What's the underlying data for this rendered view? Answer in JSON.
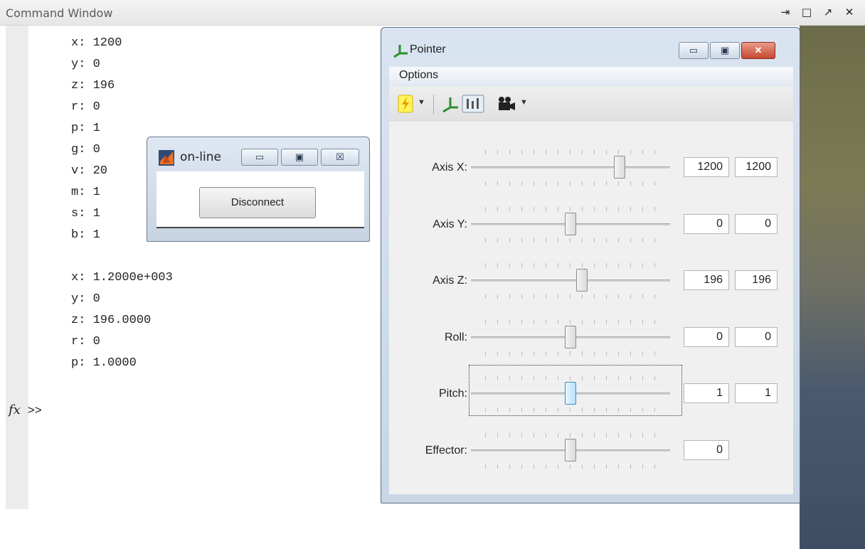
{
  "command_window": {
    "title": "Command Window",
    "controls": [
      "⇥",
      "□",
      "↗",
      "✕"
    ],
    "output_block1": [
      "x: 1200",
      "y: 0",
      "z: 196",
      "r: 0",
      "p: 1",
      "g: 0",
      "v: 20",
      "m: 1",
      "s: 1",
      "b: 1"
    ],
    "output_block2": [
      "x: 1.2000e+003",
      "y: 0",
      "z: 196.0000",
      "r: 0",
      "p: 1.0000"
    ],
    "prompt_fx": "fx",
    "prompt": ">>"
  },
  "online_window": {
    "title": "on-line",
    "disconnect_label": "Disconnect"
  },
  "pointer_window": {
    "title": "Pointer",
    "menu": [
      "Options"
    ],
    "rows": [
      {
        "label": "Axis X:",
        "value_a": "1200",
        "value_b": "1200",
        "position": 0.76
      },
      {
        "label": "Axis Y:",
        "value_a": "0",
        "value_b": "0",
        "position": 0.5
      },
      {
        "label": "Axis Z:",
        "value_a": "196",
        "value_b": "196",
        "position": 0.56
      },
      {
        "label": "Roll:",
        "value_a": "0",
        "value_b": "0",
        "position": 0.5
      },
      {
        "label": "Pitch:",
        "value_a": "1",
        "value_b": "1",
        "position": 0.5
      },
      {
        "label": "Effector:",
        "value_a": "0",
        "value_b": "",
        "position": 0.5
      }
    ]
  }
}
